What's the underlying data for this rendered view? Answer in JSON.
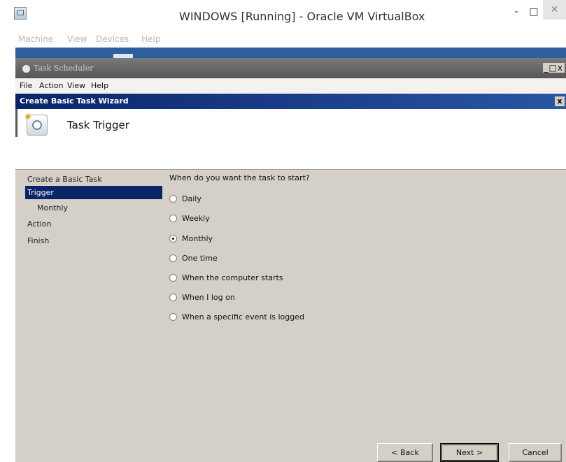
{
  "host": {
    "title": "WINDOWS [Running] - Oracle VM VirtualBox",
    "menu": [
      "Machine",
      "View",
      "Devices",
      "Help"
    ],
    "minimize_glyph": "-",
    "maximize_glyph": "□",
    "close_glyph": "✕"
  },
  "task_scheduler": {
    "title": "Task Scheduler",
    "window_controls": "_□x",
    "menu": [
      "File",
      "Action",
      "View",
      "Help"
    ]
  },
  "wizard": {
    "title": "Create Basic Task Wizard",
    "close_glyph": "x",
    "header_title": "Task Trigger",
    "nav": [
      {
        "label": "Create a Basic Task",
        "selected": false,
        "sub": false
      },
      {
        "label": "Trigger",
        "selected": true,
        "sub": false
      },
      {
        "label": "Monthly",
        "selected": false,
        "sub": true
      },
      {
        "label": "Action",
        "selected": false,
        "sub": false
      },
      {
        "label": "Finish",
        "selected": false,
        "sub": false
      }
    ],
    "question": "When do you want the task to start?",
    "options": [
      {
        "label": "Daily",
        "checked": false
      },
      {
        "label": "Weekly",
        "checked": false
      },
      {
        "label": "Monthly",
        "checked": true
      },
      {
        "label": "One time",
        "checked": false
      },
      {
        "label": "When the computer starts",
        "checked": false
      },
      {
        "label": "When I log on",
        "checked": false
      },
      {
        "label": "When a specific event is logged",
        "checked": false
      }
    ],
    "buttons": {
      "back": "< Back",
      "next": "Next >",
      "cancel": "Cancel"
    }
  },
  "icons": {
    "host_app": "virtualbox-vm-icon",
    "task_scheduler": "task-scheduler-icon",
    "wizard_header": "task-clock-icon"
  }
}
